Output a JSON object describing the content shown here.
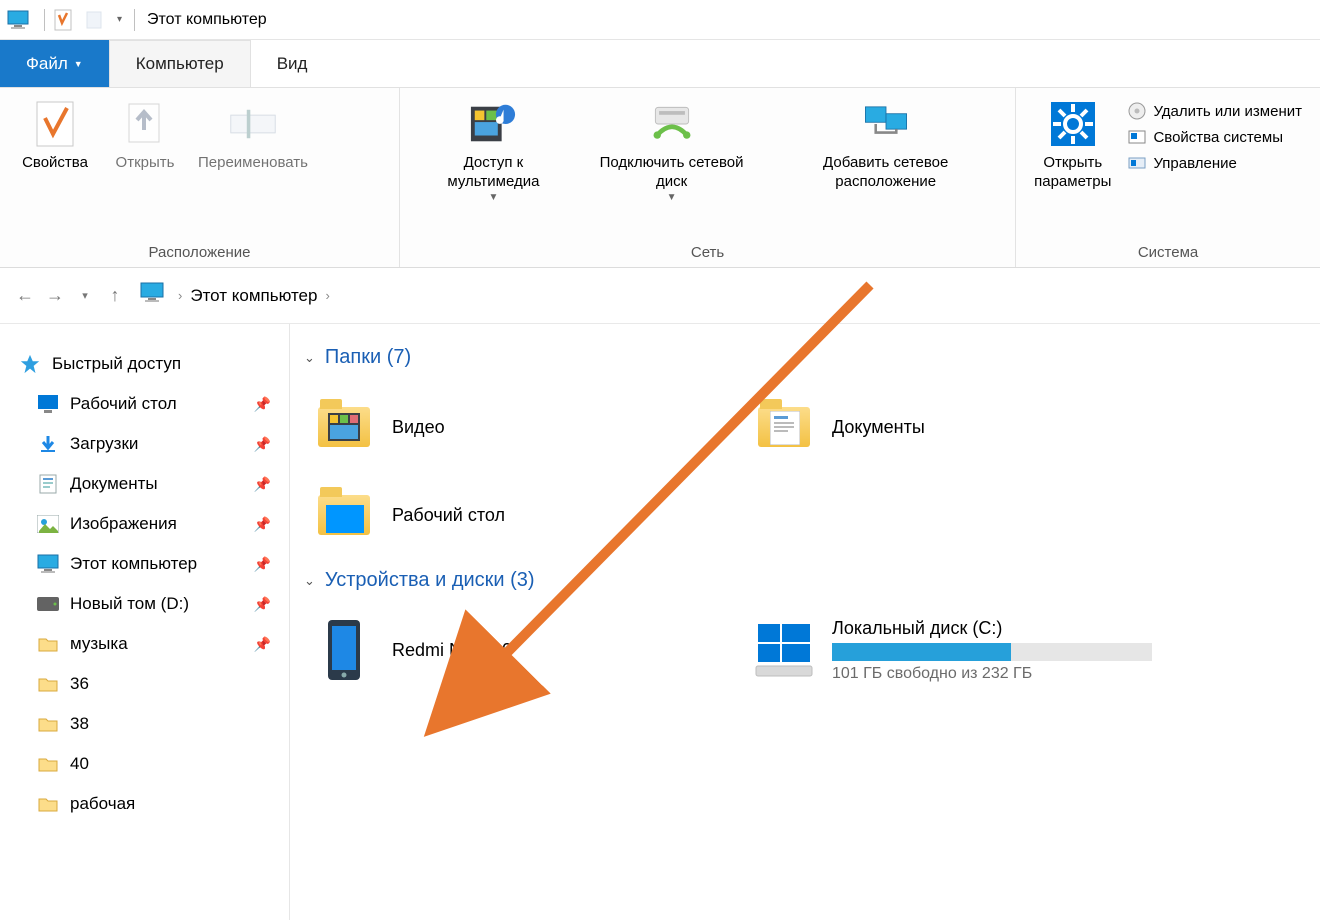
{
  "window": {
    "title": "Этот компьютер"
  },
  "tabs": {
    "file": "Файл",
    "computer": "Компьютер",
    "view": "Вид"
  },
  "ribbon": {
    "group_location": {
      "label": "Расположение",
      "properties": "Свойства",
      "open": "Открыть",
      "rename": "Переименовать"
    },
    "group_network": {
      "label": "Сеть",
      "media_access": "Доступ к мультимедиа",
      "map_drive": "Подключить сетевой диск",
      "add_location": "Добавить сетевое расположение"
    },
    "group_system": {
      "label": "Система",
      "open_settings": "Открыть параметры",
      "uninstall": "Удалить или изменит",
      "system_props": "Свойства системы",
      "manage": "Управление"
    }
  },
  "breadcrumb": {
    "root": "Этот компьютер"
  },
  "sidebar": {
    "quick_access": "Быстрый доступ",
    "items": [
      {
        "label": "Рабочий стол",
        "pinned": true,
        "icon": "desktop"
      },
      {
        "label": "Загрузки",
        "pinned": true,
        "icon": "downloads"
      },
      {
        "label": "Документы",
        "pinned": true,
        "icon": "documents"
      },
      {
        "label": "Изображения",
        "pinned": true,
        "icon": "pictures"
      },
      {
        "label": "Этот компьютер",
        "pinned": true,
        "icon": "thispc"
      },
      {
        "label": "Новый том (D:)",
        "pinned": true,
        "icon": "drive"
      },
      {
        "label": "музыка",
        "pinned": true,
        "icon": "folder"
      },
      {
        "label": "36",
        "pinned": false,
        "icon": "folder"
      },
      {
        "label": "38",
        "pinned": false,
        "icon": "folder"
      },
      {
        "label": "40",
        "pinned": false,
        "icon": "folder"
      },
      {
        "label": "рабочая",
        "pinned": false,
        "icon": "folder"
      }
    ]
  },
  "content": {
    "folders_header": "Папки (7)",
    "devices_header": "Устройства и диски (3)",
    "folders": [
      {
        "label": "Видео",
        "icon": "videos"
      },
      {
        "label": "Документы",
        "icon": "documents"
      },
      {
        "label": "Рабочий стол",
        "icon": "desktop-folder"
      }
    ],
    "devices": [
      {
        "label": "Redmi Note 10",
        "icon": "phone"
      },
      {
        "label": "Локальный диск (C:)",
        "icon": "windrive",
        "sub": "101 ГБ свободно из 232 ГБ",
        "fill_pct": 56
      }
    ]
  }
}
